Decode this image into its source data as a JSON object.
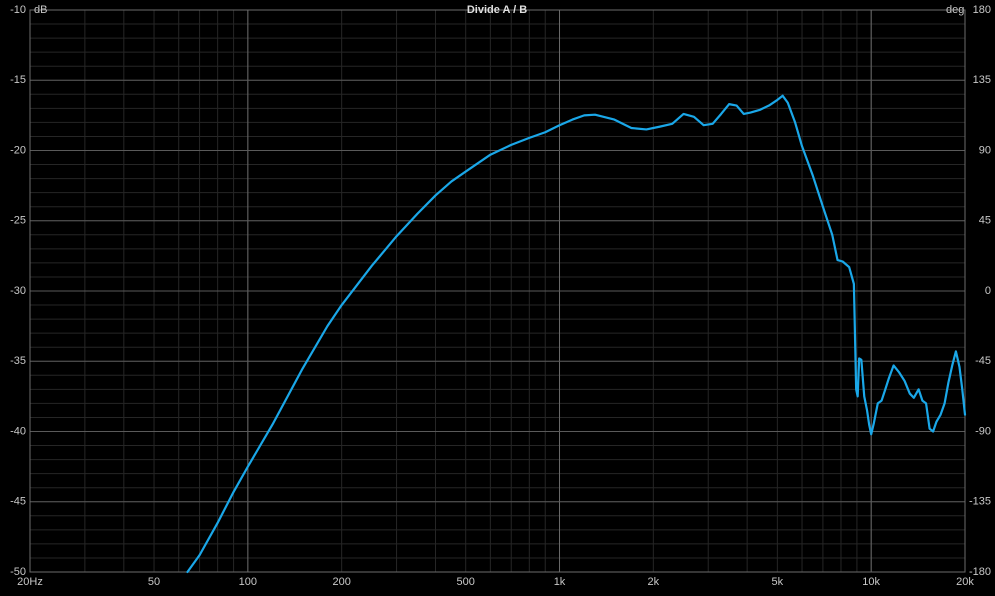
{
  "chart_data": {
    "type": "line",
    "title": "Divide A / B",
    "y_unit_left": "dB",
    "y_unit_right": "deg",
    "x_scale": "log",
    "xlim": [
      20,
      20000
    ],
    "ylim": [
      -50,
      -10
    ],
    "ylim_right": [
      -180,
      180
    ],
    "grid": true,
    "x_ticks": [
      {
        "value": 20,
        "label": "20Hz"
      },
      {
        "value": 50,
        "label": "50"
      },
      {
        "value": 100,
        "label": "100"
      },
      {
        "value": 200,
        "label": "200"
      },
      {
        "value": 500,
        "label": "500"
      },
      {
        "value": 1000,
        "label": "1k"
      },
      {
        "value": 2000,
        "label": "2k"
      },
      {
        "value": 5000,
        "label": "5k"
      },
      {
        "value": 10000,
        "label": "10k"
      },
      {
        "value": 20000,
        "label": "20k"
      }
    ],
    "y_ticks_left": [
      -10,
      -15,
      -20,
      -25,
      -30,
      -35,
      -40,
      -45,
      -50
    ],
    "y_ticks_right": [
      180,
      135,
      90,
      45,
      0,
      -45,
      -90,
      -135,
      -180
    ],
    "series": [
      {
        "color": "#1aa7e8",
        "x": [
          64,
          70,
          80,
          90,
          100,
          120,
          150,
          180,
          200,
          250,
          300,
          350,
          400,
          450,
          500,
          600,
          700,
          800,
          900,
          1000,
          1100,
          1200,
          1300,
          1500,
          1700,
          1900,
          2100,
          2300,
          2500,
          2700,
          2900,
          3100,
          3300,
          3500,
          3700,
          3900,
          4100,
          4400,
          4700,
          5000,
          5200,
          5400,
          5700,
          6000,
          6500,
          7000,
          7500,
          7800,
          8100,
          8500,
          8800,
          8950,
          9050,
          9150,
          9300,
          9500,
          9700,
          9850,
          10000,
          10200,
          10500,
          10800,
          11100,
          11400,
          11800,
          12300,
          12800,
          13300,
          13700,
          14200,
          14600,
          15000,
          15400,
          15800,
          16200,
          16700,
          17200,
          17700,
          18200,
          18700,
          19200,
          19600,
          20000
        ],
        "y": [
          -50.0,
          -48.8,
          -46.5,
          -44.3,
          -42.5,
          -39.5,
          -35.5,
          -32.5,
          -31.0,
          -28.2,
          -26.1,
          -24.5,
          -23.2,
          -22.2,
          -21.5,
          -20.3,
          -19.6,
          -19.1,
          -18.7,
          -18.2,
          -17.8,
          -17.5,
          -17.45,
          -17.8,
          -18.4,
          -18.5,
          -18.3,
          -18.1,
          -17.4,
          -17.6,
          -18.2,
          -18.1,
          -17.4,
          -16.7,
          -16.8,
          -17.4,
          -17.3,
          -17.1,
          -16.8,
          -16.4,
          -16.1,
          -16.6,
          -18.0,
          -19.7,
          -21.8,
          -24.0,
          -26.0,
          -27.8,
          -27.9,
          -28.3,
          -29.5,
          -37.0,
          -37.5,
          -34.8,
          -34.9,
          -37.5,
          -38.5,
          -39.5,
          -40.2,
          -39.4,
          -38.0,
          -37.8,
          -37.0,
          -36.2,
          -35.3,
          -35.8,
          -36.4,
          -37.3,
          -37.6,
          -37.0,
          -37.8,
          -38.0,
          -39.8,
          -40.0,
          -39.3,
          -38.8,
          -38.0,
          -36.5,
          -35.3,
          -34.3,
          -35.4,
          -37.0,
          -38.8
        ]
      }
    ]
  }
}
